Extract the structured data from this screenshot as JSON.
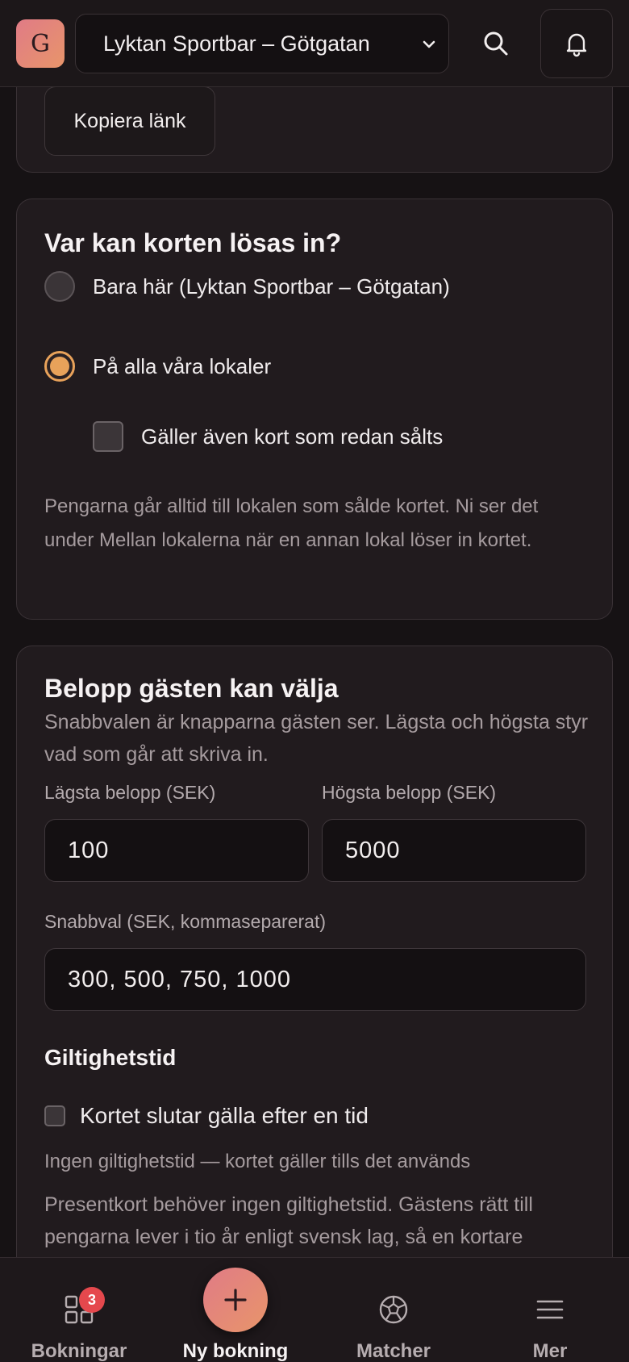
{
  "header": {
    "logo_letter": "G",
    "venue": "Lyktan Sportbar – Götgatan"
  },
  "share": {
    "copy_link_label": "Kopiera länk"
  },
  "redeem": {
    "title": "Var kan korten lösas in?",
    "options": [
      {
        "label": "Bara här (Lyktan Sportbar – Götgatan)",
        "selected": false
      },
      {
        "label": "På alla våra lokaler",
        "selected": true
      }
    ],
    "include_sold_label": "Gäller även kort som redan sålts",
    "include_sold_checked": false,
    "help": "Pengarna går alltid till lokalen som sålde kortet. Ni ser det under Mellan lokalerna när en annan lokal löser in kortet."
  },
  "amount": {
    "title": "Belopp gästen kan välja",
    "subtitle": "Snabbvalen är knapparna gästen ser. Lägsta och högsta styr vad som går att skriva in.",
    "min_label": "Lägsta belopp (SEK)",
    "min_value": "100",
    "max_label": "Högsta belopp (SEK)",
    "max_value": "5000",
    "quick_label": "Snabbval (SEK, kommaseparerat)",
    "quick_value": "300, 500, 750, 1000"
  },
  "validity": {
    "title": "Giltighetstid",
    "expires_label": "Kortet slutar gälla efter en tid",
    "expires_checked": false,
    "status": "Ingen giltighetstid — kortet gäller tills det används",
    "info": "Presentkort behöver ingen giltighetstid. Gästens rätt till pengarna lever i tio år enligt svensk lag, så en kortare"
  },
  "nav": {
    "bookings_label": "Bokningar",
    "bookings_badge": "3",
    "new_booking_label": "Ny bokning",
    "matches_label": "Matcher",
    "more_label": "Mer"
  }
}
